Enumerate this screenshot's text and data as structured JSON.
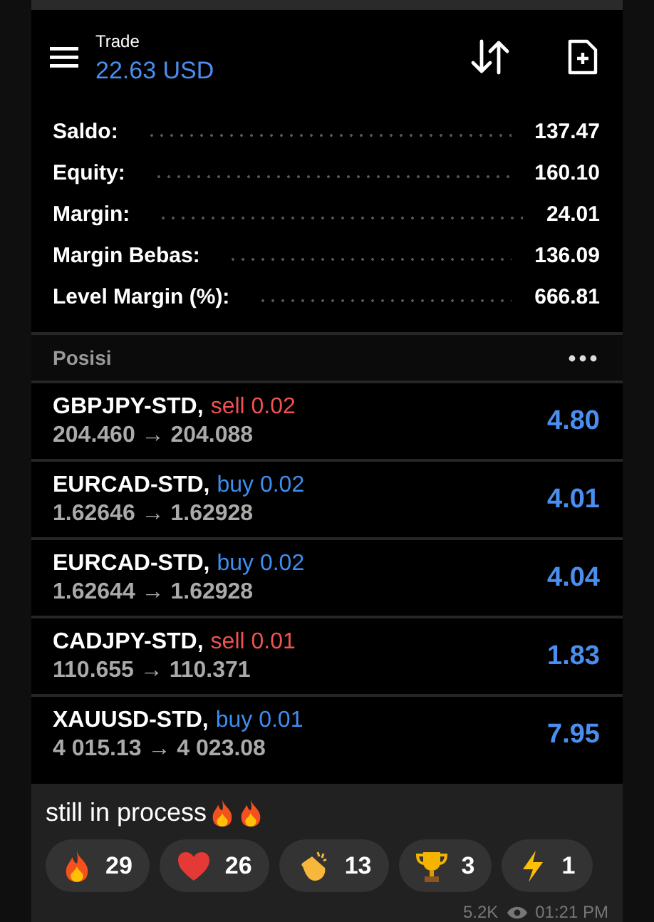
{
  "header": {
    "title": "Trade",
    "balance": "22.63 USD"
  },
  "summary": [
    {
      "label": "Saldo:",
      "value": "137.47"
    },
    {
      "label": "Equity:",
      "value": "160.10"
    },
    {
      "label": "Margin:",
      "value": "24.01"
    },
    {
      "label": "Margin Bebas:",
      "value": "136.09"
    },
    {
      "label": "Level Margin (%):",
      "value": "666.81"
    }
  ],
  "positions_header": "Posisi",
  "positions": [
    {
      "symbol": "GBPJPY-STD,",
      "order": "sell 0.02",
      "color": "#f0524f",
      "prices": "204.460 → 204.088",
      "profit": "4.80"
    },
    {
      "symbol": "EURCAD-STD,",
      "order": "buy 0.02",
      "color": "#3d8ef0",
      "prices": "1.62646 → 1.62928",
      "profit": "4.01"
    },
    {
      "symbol": "EURCAD-STD,",
      "order": "buy 0.02",
      "color": "#3d8ef0",
      "prices": "1.62644 → 1.62928",
      "profit": "4.04"
    },
    {
      "symbol": "CADJPY-STD,",
      "order": "sell 0.01",
      "color": "#f0524f",
      "prices": "110.655 → 110.371",
      "profit": "1.83"
    },
    {
      "symbol": "XAUUSD-STD,",
      "order": "buy 0.01",
      "color": "#3d8ef0",
      "prices": "4 015.13 → 4 023.08",
      "profit": "7.95"
    }
  ],
  "caption": {
    "text": "still in process",
    "emoji": [
      {
        "kind": "fire"
      },
      {
        "kind": "fire"
      }
    ]
  },
  "reactions": [
    {
      "kind": "fire",
      "count": "29"
    },
    {
      "kind": "heart",
      "count": "26"
    },
    {
      "kind": "clap",
      "count": "13"
    },
    {
      "kind": "trophy",
      "count": "3"
    },
    {
      "kind": "bolt",
      "count": "1"
    }
  ],
  "meta": {
    "views": "5.2K",
    "time": "01:21 PM"
  }
}
